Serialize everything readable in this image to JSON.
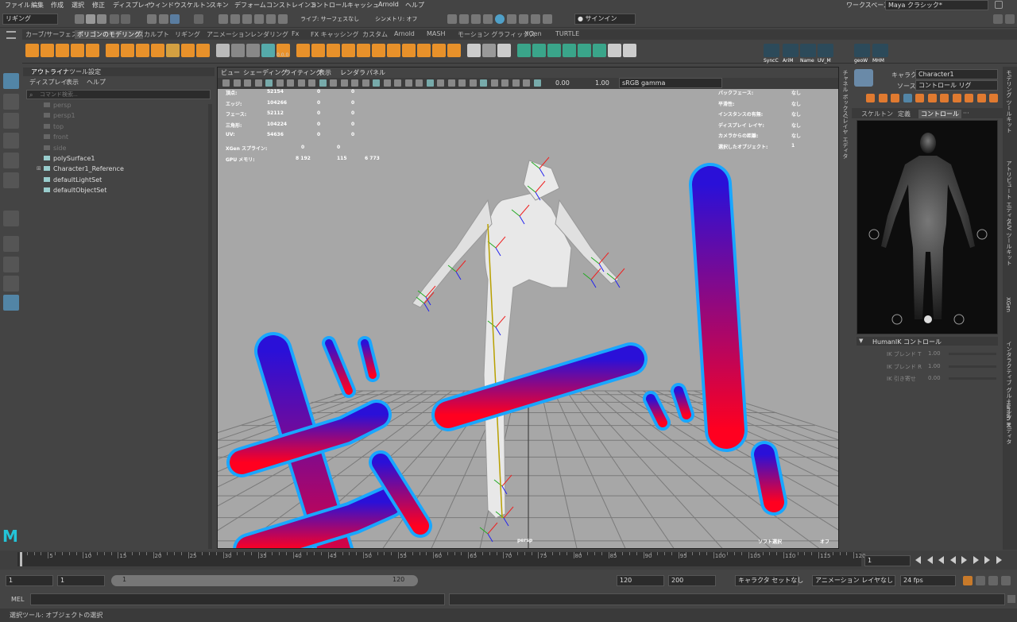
{
  "menubar": {
    "items": [
      "ファイル",
      "編集",
      "作成",
      "選択",
      "修正",
      "ディスプレイ",
      "ウィンドウ",
      "スケルトン",
      "スキン",
      "デフォーム",
      "コンストレイント",
      "コントロール",
      "キャッシュ",
      "Arnold",
      "ヘルプ"
    ],
    "workspace_label": "ワークスペース:",
    "workspace_value": "Maya クラシック*"
  },
  "statusline": {
    "mode": "リギング",
    "live_surface": "ライブ: サーフェスなし",
    "symmetry": "シンメトリ: オフ",
    "signin": "サインイン"
  },
  "shelf": {
    "tabs": [
      "カーブ/サーフェス",
      "ポリゴンのモデリング",
      "スカルプト",
      "リギング",
      "アニメーション",
      "レンダリング",
      "Fx",
      "FX キャッシング",
      "カスタム",
      "Arnold",
      "MASH",
      "モーション グラフィックス",
      "XGen",
      "TURTLE"
    ],
    "active_tab": "ポリゴンのモデリング",
    "labels": [
      "SyncC",
      "AriM",
      "Name",
      "UV_M",
      "geoW",
      "MHM"
    ],
    "zero_label": "0.0.0"
  },
  "outliner": {
    "tabs": [
      "アウトライナ",
      "ツール設定"
    ],
    "menu": [
      "ディスプレイ",
      "表示",
      "ヘルプ"
    ],
    "search_placeholder": "コマンド検索...",
    "items": [
      {
        "name": "persp",
        "dim": true
      },
      {
        "name": "persp1",
        "dim": true
      },
      {
        "name": "top",
        "dim": true
      },
      {
        "name": "front",
        "dim": true
      },
      {
        "name": "side",
        "dim": true
      },
      {
        "name": "polySurface1",
        "dim": false
      },
      {
        "name": "Character1_Reference",
        "dim": false
      },
      {
        "name": "defaultLightSet",
        "dim": false
      },
      {
        "name": "defaultObjectSet",
        "dim": false
      }
    ]
  },
  "viewport": {
    "menu": [
      "ビュー",
      "シェーディング",
      "ライティング",
      "表示",
      "レンダラ",
      "パネル"
    ],
    "exposure": "0.00",
    "gamma": "1.00",
    "colorspace": "sRGB gamma",
    "hud_left": [
      {
        "label": "頂点:",
        "a": "52154",
        "b": "0",
        "c": "0"
      },
      {
        "label": "エッジ:",
        "a": "104266",
        "b": "0",
        "c": "0"
      },
      {
        "label": "フェース:",
        "a": "52112",
        "b": "0",
        "c": "0"
      },
      {
        "label": "三角形:",
        "a": "104224",
        "b": "0",
        "c": "0"
      },
      {
        "label": "UV:",
        "a": "54636",
        "b": "0",
        "c": "0"
      },
      {
        "label": "XGen スプライン:",
        "a": "0",
        "b": "0",
        "c": ""
      },
      {
        "label": "GPU メモリ:",
        "a": "8 192",
        "b": "115",
        "c": "6 773"
      }
    ],
    "hud_right": [
      {
        "label": "バックフェース:",
        "value": "なし"
      },
      {
        "label": "平滑性:",
        "value": "なし"
      },
      {
        "label": "インスタンスの有無:",
        "value": "なし"
      },
      {
        "label": "ディスプレイ レイヤ:",
        "value": "なし"
      },
      {
        "label": "カメラからの距離:",
        "value": "なし"
      },
      {
        "label": "選択したオブジェクト:",
        "value": "1"
      }
    ],
    "camera": "persp",
    "soft_select": "ソフト選択",
    "soft_value": "オフ",
    "overlay_text": "ギャーッ!"
  },
  "hik": {
    "character_label": "キャラクタ:",
    "character_value": "Character1",
    "source_label": "ソース:",
    "source_value": "コントロール リグ",
    "tabs": [
      "スケルトン",
      "定義",
      "コントロール",
      "···"
    ],
    "active_tab": "コントロール",
    "section": "HumanIK コントロール",
    "rows": [
      {
        "label": "IK ブレンド T",
        "value": "1.00"
      },
      {
        "label": "IK ブレンド R",
        "value": "1.00"
      },
      {
        "label": "IK 引き寄せ",
        "value": "0.00"
      }
    ]
  },
  "attr_strip_label": "チャネル ボックス/レイヤ エディタ",
  "right_tabs": [
    "モデリング ツールキット",
    "アトリビュート エディタ",
    "UV ツールキット",
    "XGen",
    "インタラクティブ グルーミング エディタ",
    "Human IK"
  ],
  "timeline": {
    "ticks": [
      "5",
      "10",
      "15",
      "20",
      "25",
      "30",
      "35",
      "40",
      "45",
      "50",
      "55",
      "60",
      "65",
      "70",
      "75",
      "80",
      "85",
      "90",
      "95",
      "100",
      "105",
      "110",
      "115",
      "120"
    ],
    "current_frame": "1"
  },
  "range": {
    "start": "1",
    "inner_start": "1",
    "slider_start": "1",
    "slider_end": "120",
    "end": "120",
    "outer_end": "200",
    "char_set": "キャラクタ セットなし",
    "anim_layer": "アニメーション レイヤなし",
    "fps": "24 fps"
  },
  "cmd": {
    "label": "MEL"
  },
  "help": {
    "text": "選択ツール: オブジェクトの選択"
  },
  "colors": {
    "accent": "#5285a6",
    "overlay_top": "#2a10d8",
    "overlay_bottom": "#ff0020",
    "overlay_stroke": "#19a6ff"
  }
}
